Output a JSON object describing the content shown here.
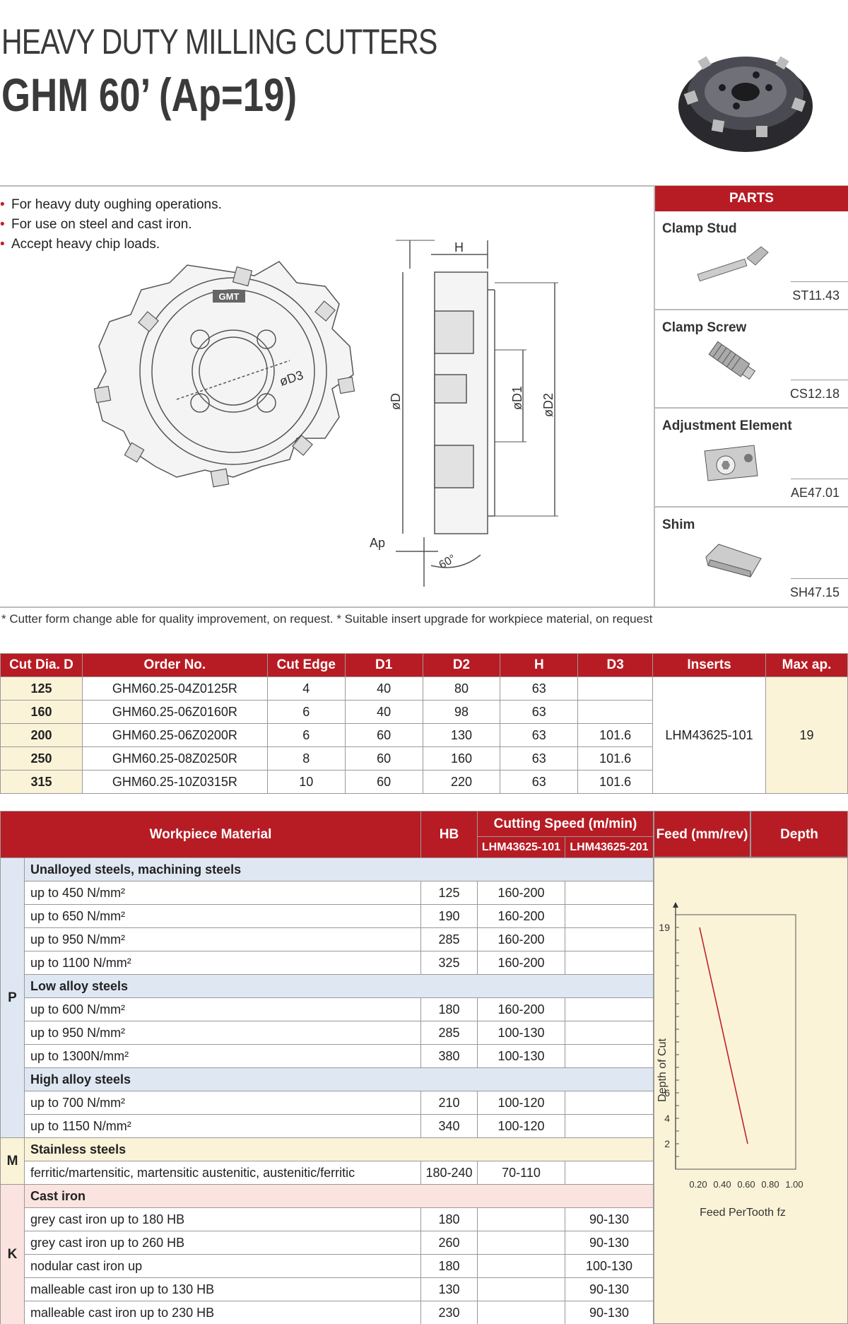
{
  "header": {
    "title_line1": "HEAVY DUTY MILLING CUTTERS",
    "title_line2": "GHM 60’ (Ap=19)"
  },
  "features": [
    "For heavy duty oughing operations.",
    "For use on steel and cast iron.",
    "Accept heavy chip loads."
  ],
  "drawing": {
    "logo": "GMT",
    "labels": {
      "H": "H",
      "D": "øD",
      "D1": "øD1",
      "D2": "øD2",
      "D3": "øD3",
      "Ap": "Ap",
      "angle": "60°"
    }
  },
  "parts": {
    "heading": "PARTS",
    "items": [
      {
        "name": "Clamp Stud",
        "code": "ST11.43",
        "icon": "clamp-stud-icon"
      },
      {
        "name": "Clamp Screw",
        "code": "CS12.18",
        "icon": "clamp-screw-icon"
      },
      {
        "name": "Adjustment Element",
        "code": "AE47.01",
        "icon": "adjustment-element-icon"
      },
      {
        "name": "Shim",
        "code": "SH47.15",
        "icon": "shim-icon"
      }
    ]
  },
  "note": "* Cutter form change able for quality improvement, on request.  * Suitable insert upgrade for workpiece material, on request",
  "spec_table": {
    "headers": [
      "Cut Dia. D",
      "Order No.",
      "Cut Edge",
      "D1",
      "D2",
      "H",
      "D3",
      "Inserts",
      "Max ap."
    ],
    "rows": [
      {
        "dia": "125",
        "order": "GHM60.25-04Z0125R",
        "edge": "4",
        "d1": "40",
        "d2": "80",
        "h": "63",
        "d3": ""
      },
      {
        "dia": "160",
        "order": "GHM60.25-06Z0160R",
        "edge": "6",
        "d1": "40",
        "d2": "98",
        "h": "63",
        "d3": ""
      },
      {
        "dia": "200",
        "order": "GHM60.25-06Z0200R",
        "edge": "6",
        "d1": "60",
        "d2": "130",
        "h": "63",
        "d3": "101.6"
      },
      {
        "dia": "250",
        "order": "GHM60.25-08Z0250R",
        "edge": "8",
        "d1": "60",
        "d2": "160",
        "h": "63",
        "d3": "101.6"
      },
      {
        "dia": "315",
        "order": "GHM60.25-10Z0315R",
        "edge": "10",
        "d1": "60",
        "d2": "220",
        "h": "63",
        "d3": "101.6"
      }
    ],
    "inserts": "LHM43625-101",
    "max_ap": "19"
  },
  "cutting_table": {
    "headers": {
      "material": "Workpiece Material",
      "hb": "HB",
      "speed": "Cutting Speed (m/min)",
      "speed_a": "LHM43625-101",
      "speed_b": "LHM43625-201",
      "feed": "Feed (mm/rev)",
      "depth": "Depth"
    },
    "iso": {
      "P": "P",
      "M": "M",
      "K": "K"
    },
    "groups": [
      {
        "iso": "P",
        "name": "Unalloyed steels, machining steels",
        "rows": [
          {
            "mat": "up to 450 N/mm²",
            "hb": "125",
            "a": "160-200",
            "b": ""
          },
          {
            "mat": "up to 650 N/mm²",
            "hb": "190",
            "a": "160-200",
            "b": ""
          },
          {
            "mat": "up to 950 N/mm²",
            "hb": "285",
            "a": "160-200",
            "b": ""
          },
          {
            "mat": "up to 1100 N/mm²",
            "hb": "325",
            "a": "160-200",
            "b": ""
          }
        ]
      },
      {
        "iso": "P",
        "name": "Low alloy steels",
        "rows": [
          {
            "mat": "up to 600 N/mm²",
            "hb": "180",
            "a": "160-200",
            "b": ""
          },
          {
            "mat": "up to 950 N/mm²",
            "hb": "285",
            "a": "100-130",
            "b": ""
          },
          {
            "mat": "up to 1300N/mm²",
            "hb": "380",
            "a": "100-130",
            "b": ""
          }
        ]
      },
      {
        "iso": "P",
        "name": "High alloy steels",
        "rows": [
          {
            "mat": "up to 700 N/mm²",
            "hb": "210",
            "a": "100-120",
            "b": ""
          },
          {
            "mat": "up to 1150 N/mm²",
            "hb": "340",
            "a": "100-120",
            "b": ""
          }
        ]
      },
      {
        "iso": "M",
        "name": "Stainless steels",
        "rows": [
          {
            "mat": "ferritic/martensitic, martensitic austenitic, austenitic/ferritic",
            "hb": "180-240",
            "a": "70-110",
            "b": ""
          }
        ]
      },
      {
        "iso": "K",
        "name": "Cast iron",
        "rows": [
          {
            "mat": "grey cast iron up to 180 HB",
            "hb": "180",
            "a": "",
            "b": "90-130"
          },
          {
            "mat": "grey cast iron up to 260 HB",
            "hb": "260",
            "a": "",
            "b": "90-130"
          },
          {
            "mat": "nodular cast iron up",
            "hb": "180",
            "a": "",
            "b": "100-130"
          },
          {
            "mat": "malleable cast iron up to 130 HB",
            "hb": "130",
            "a": "",
            "b": "90-130"
          },
          {
            "mat": "malleable cast iron up to 230 HB",
            "hb": "230",
            "a": "",
            "b": "90-130"
          }
        ]
      }
    ]
  },
  "chart_data": {
    "type": "line",
    "xlabel": "Feed PerTooth fz",
    "ylabel": "Depth of Cut",
    "x_ticks": [
      "0.20",
      "0.40",
      "0.60",
      "0.80",
      "1.00"
    ],
    "y_ticks": [
      "2",
      "4",
      "6",
      "19"
    ],
    "xlim": [
      0,
      1.0
    ],
    "ylim": [
      0,
      20
    ],
    "series": [
      {
        "x": [
          0.2,
          0.6
        ],
        "y": [
          19,
          2
        ]
      }
    ],
    "line_color": "#c0202a",
    "grid": false
  }
}
